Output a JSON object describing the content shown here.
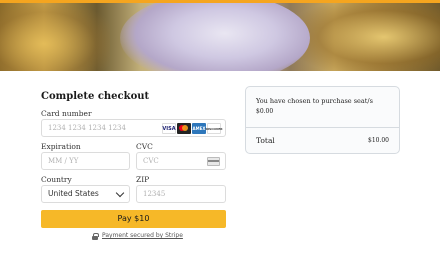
{
  "checkout": {
    "title": "Complete checkout",
    "card_number": {
      "label": "Card number",
      "placeholder": "1234 1234 1234 1234"
    },
    "card_logos": [
      "VISA",
      "",
      "AMEX",
      "DISCOVER"
    ],
    "expiration": {
      "label": "Expiration",
      "placeholder": "MM / YY"
    },
    "cvc": {
      "label": "CVC",
      "placeholder": "CVC"
    },
    "country": {
      "label": "Country",
      "value": "United States"
    },
    "zip": {
      "label": "ZIP",
      "placeholder": "12345"
    },
    "pay_label": "Pay $10",
    "secured_text": "Payment secured by Stripe"
  },
  "summary": {
    "description": "You have chosen to purchase seat/s",
    "price": "$0.00",
    "total_label": "Total",
    "total_value": "$10.00"
  },
  "colors": {
    "accent": "#f6b828",
    "top_strip": "#f5a51f",
    "border": "#dcdcdc"
  }
}
